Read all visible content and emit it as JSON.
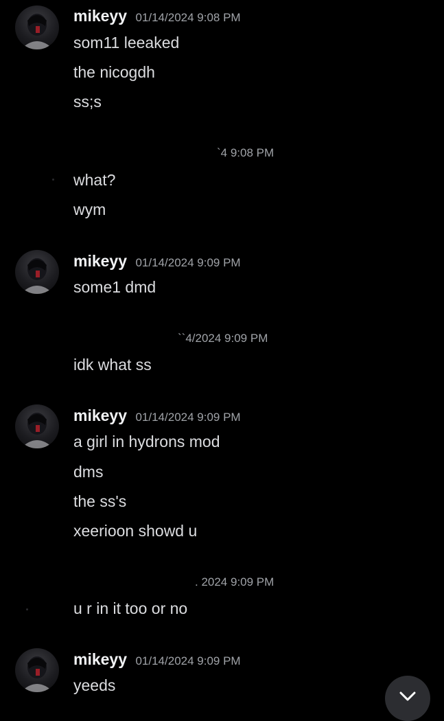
{
  "colors": {
    "background": "#000000",
    "username": "#f2f3f5",
    "timestamp": "#a0a3a8",
    "message_text": "#dcdde0",
    "scroll_button": "#2c2d31"
  },
  "groups": [
    {
      "username": "mikeyy",
      "timestamp": "01/14/2024 9:08 PM",
      "messages": [
        "som11 leeaked",
        "the nicogdh",
        "ss;s"
      ]
    },
    {
      "timestamp": "`4 9:08 PM",
      "messages": [
        "what?",
        "wym"
      ]
    },
    {
      "username": "mikeyy",
      "timestamp": "01/14/2024 9:09 PM",
      "messages": [
        "some1 dmd"
      ]
    },
    {
      "timestamp": "``4/2024 9:09 PM",
      "messages": [
        "idk what ss"
      ]
    },
    {
      "username": "mikeyy",
      "timestamp": "01/14/2024 9:09 PM",
      "messages": [
        "a girl in hydrons mod",
        "dms",
        "the ss's",
        "xeerioon showd u"
      ]
    },
    {
      "timestamp": ". 2024 9:09 PM",
      "messages": [
        "u r in it too or no"
      ]
    },
    {
      "username": "mikeyy",
      "timestamp": "01/14/2024 9:09 PM",
      "messages": [
        "yeeds"
      ]
    }
  ],
  "scroll_button_icon": "chevron-down-icon"
}
